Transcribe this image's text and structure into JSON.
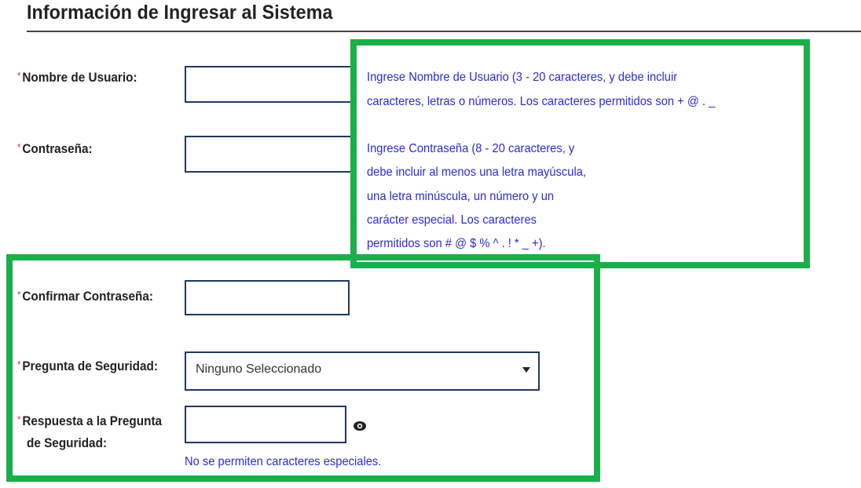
{
  "section": {
    "title": "Información de Ingresar al Sistema"
  },
  "required_marker": "*",
  "fields": {
    "username": {
      "label": "Nombre de Usuario:",
      "value": ""
    },
    "password": {
      "label": "Contraseña:",
      "value": ""
    },
    "confirm_password": {
      "label": "Confirmar Contraseña:",
      "value": ""
    },
    "security_question": {
      "label": "Pregunta de Seguridad:",
      "selected": "Ninguno Seleccionado"
    },
    "security_answer": {
      "label_line1": "Respuesta a la Pregunta",
      "label_line2": "de Seguridad:",
      "value": ""
    }
  },
  "hints": {
    "username": [
      "Ingrese Nombre de Usuario (3 - 20 caracteres, y debe incluir",
      "caracteres, letras o números. Los caracteres permitidos son + @ . _"
    ],
    "password": [
      "Ingrese Contraseña (8 - 20 caracteres, y",
      "debe incluir al menos una letra mayúscula,",
      "una letra minúscula, un número y un",
      "carácter especial. Los caracteres",
      "permitidos son # @ $ % ^ . ! * _ +)."
    ],
    "security_answer": "No se permiten caracteres especiales."
  },
  "icons": {
    "toggle_visibility": "eye-icon",
    "dropdown": "chevron-down-icon"
  },
  "colors": {
    "highlight": "#19b04a",
    "hint_text": "#2b2bd6",
    "required": "#c0392b",
    "input_border": "#1f3864"
  }
}
